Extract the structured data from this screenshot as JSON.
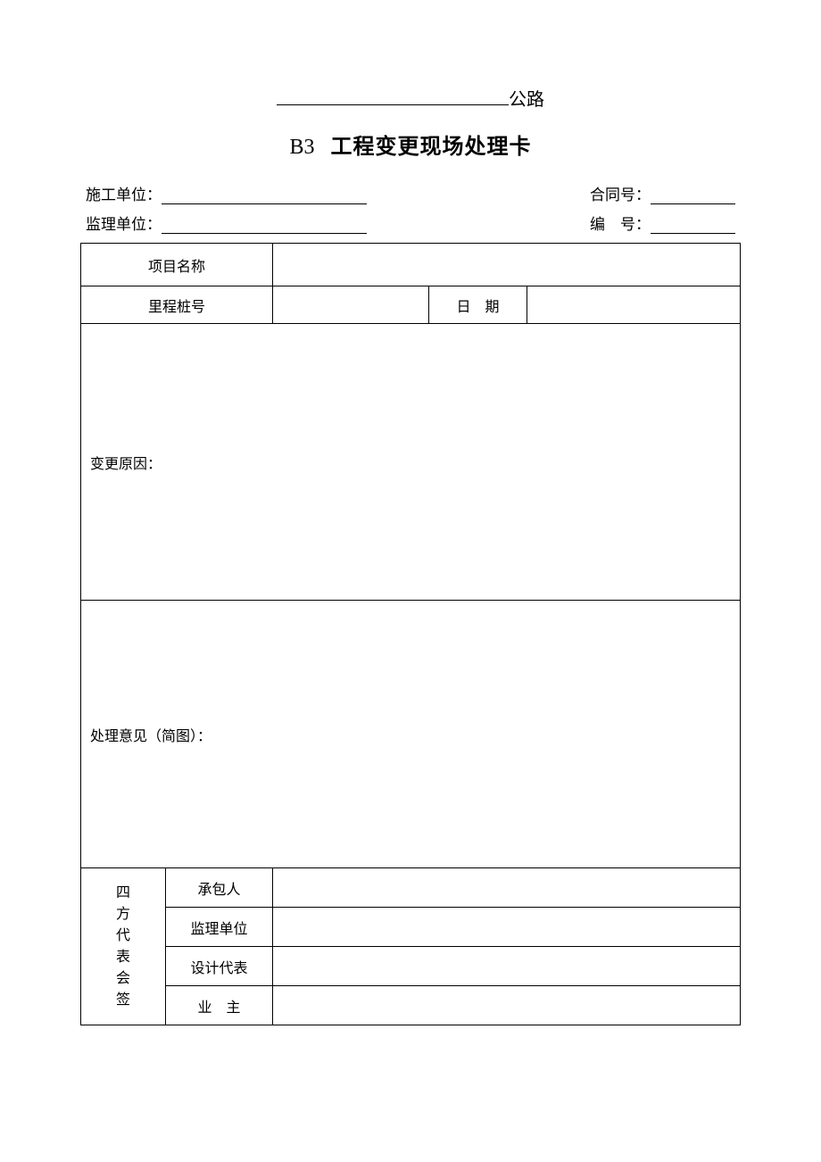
{
  "header": {
    "suffix": "公路"
  },
  "title": {
    "code": "B3",
    "main": "工程变更现场处理卡"
  },
  "info": {
    "construction_unit_label": "施工单位：",
    "construction_unit_value": "",
    "contract_no_label": "合同号：",
    "contract_no_value": "",
    "supervision_unit_label": "监理单位：",
    "supervision_unit_value": "",
    "serial_no_label": "编　号：",
    "serial_no_value": ""
  },
  "table": {
    "project_name_label": "项目名称",
    "project_name_value": "",
    "mileage_label": "里程桩号",
    "mileage_value": "",
    "date_label": "日　期",
    "date_value": "",
    "reason_label": "变更原因：",
    "reason_value": "",
    "opinion_label": "处理意见（简图）：",
    "opinion_value": "",
    "sig_group_label": "四方代表会签",
    "sig_contractor": "承包人",
    "sig_supervisor": "监理单位",
    "sig_designer": "设计代表",
    "sig_owner": "业　主",
    "sig_contractor_value": "",
    "sig_supervisor_value": "",
    "sig_designer_value": "",
    "sig_owner_value": ""
  }
}
